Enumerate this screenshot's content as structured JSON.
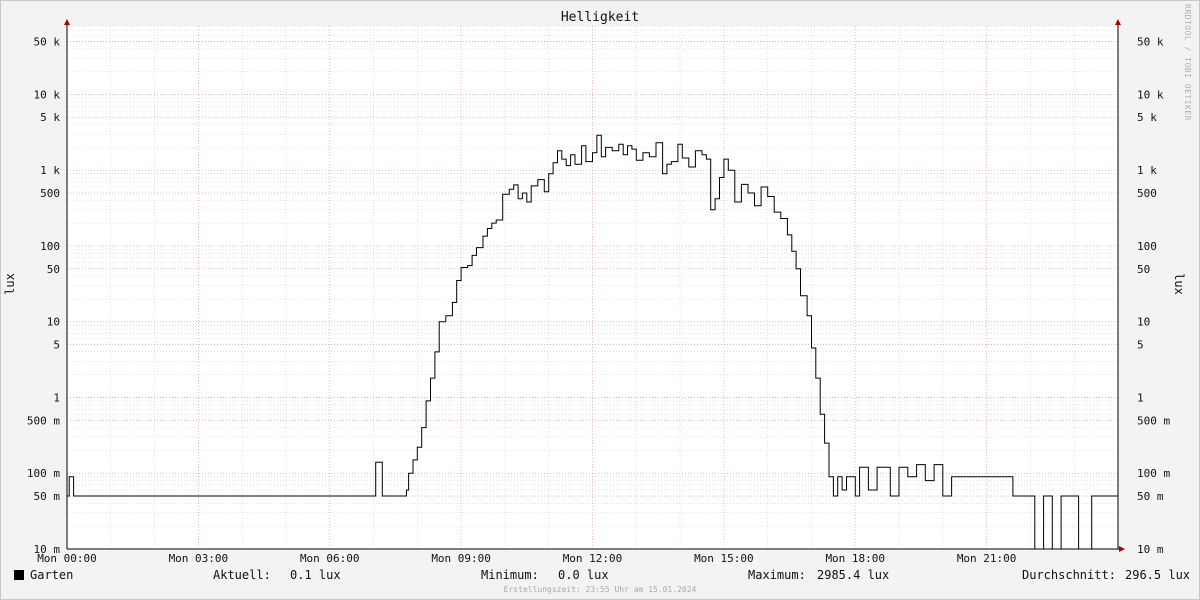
{
  "chart_data": {
    "type": "line",
    "title": "Helligkeit",
    "ylabel": "lux",
    "y_scale": "log",
    "ylim": [
      10,
      80000
    ],
    "y_ticks": [
      {
        "value": 50000,
        "label": "50 k"
      },
      {
        "value": 10000,
        "label": "10 k"
      },
      {
        "value": 5000,
        "label": "5 k"
      },
      {
        "value": 1000,
        "label": "1 k"
      },
      {
        "value": 500,
        "label": "500"
      },
      {
        "value": 100,
        "label": "100"
      },
      {
        "value": 50,
        "label": "50"
      },
      {
        "value": 10,
        "label": "10"
      },
      {
        "value": 5,
        "label": "5"
      },
      {
        "value": 1,
        "label": "1"
      },
      {
        "value": 0.5,
        "label": "500 m"
      },
      {
        "value": 0.1,
        "label": "100 m"
      },
      {
        "value": 0.05,
        "label": "50 m"
      },
      {
        "value": 0.01,
        "label": "10 m"
      }
    ],
    "x_ticks": [
      "Mon 00:00",
      "Mon 03:00",
      "Mon 06:00",
      "Mon 09:00",
      "Mon 12:00",
      "Mon 15:00",
      "Mon 18:00",
      "Mon 21:00"
    ],
    "x_unit": "hours",
    "xlim": [
      0,
      24
    ],
    "grid": true,
    "series": [
      {
        "name": "Garten",
        "color": "#000000",
        "x": [
          0,
          0.05,
          0.15,
          0.2,
          7.0,
          7.05,
          7.2,
          7.3,
          7.75,
          7.8,
          7.9,
          8.0,
          8.1,
          8.2,
          8.3,
          8.4,
          8.5,
          8.65,
          8.8,
          8.9,
          9.0,
          9.15,
          9.25,
          9.35,
          9.5,
          9.6,
          9.7,
          9.8,
          9.95,
          10.1,
          10.2,
          10.3,
          10.4,
          10.5,
          10.6,
          10.75,
          10.9,
          11.0,
          11.1,
          11.2,
          11.3,
          11.4,
          11.5,
          11.6,
          11.75,
          11.85,
          12.0,
          12.1,
          12.2,
          12.3,
          12.45,
          12.6,
          12.7,
          12.8,
          12.9,
          13.0,
          13.15,
          13.3,
          13.45,
          13.6,
          13.7,
          13.8,
          13.95,
          14.05,
          14.2,
          14.35,
          14.5,
          14.6,
          14.7,
          14.8,
          14.9,
          15.0,
          15.1,
          15.25,
          15.4,
          15.55,
          15.7,
          15.85,
          16.0,
          16.15,
          16.3,
          16.45,
          16.55,
          16.65,
          16.75,
          16.9,
          17.0,
          17.1,
          17.2,
          17.3,
          17.4,
          17.5,
          17.6,
          17.7,
          17.8,
          18.0,
          18.1,
          18.3,
          18.5,
          18.8,
          19.0,
          19.2,
          19.4,
          19.6,
          19.8,
          20.0,
          20.2,
          20.4,
          20.7,
          21.0,
          21.3,
          21.6,
          21.9,
          22.1,
          22.3,
          22.5,
          22.7,
          22.9,
          23.1,
          23.4,
          24.0
        ],
        "y": [
          0.05,
          0.09,
          0.05,
          0.05,
          0.05,
          0.14,
          0.05,
          0.05,
          0.06,
          0.1,
          0.15,
          0.22,
          0.4,
          0.9,
          1.8,
          4.0,
          10.0,
          12.0,
          18.0,
          35.0,
          52.0,
          55.0,
          75.0,
          95.0,
          135.0,
          170.0,
          200.0,
          220.0,
          480.0,
          560.0,
          640.0,
          420.0,
          500.0,
          380.0,
          620.0,
          750.0,
          520.0,
          900.0,
          1250.0,
          1800.0,
          1400.0,
          1150.0,
          1600.0,
          1200.0,
          2100.0,
          1300.0,
          1700.0,
          2900.0,
          1500.0,
          2000.0,
          1800.0,
          2200.0,
          1600.0,
          2100.0,
          1900.0,
          1350.0,
          1700.0,
          1500.0,
          2300.0,
          900.0,
          1200.0,
          1300.0,
          2200.0,
          1450.0,
          1100.0,
          1800.0,
          1600.0,
          1400.0,
          300.0,
          420.0,
          800.0,
          1400.0,
          1000.0,
          380.0,
          650.0,
          500.0,
          340.0,
          600.0,
          450.0,
          280.0,
          230.0,
          140.0,
          85.0,
          50.0,
          22.0,
          12.0,
          4.5,
          1.8,
          0.6,
          0.25,
          0.09,
          0.05,
          0.09,
          0.06,
          0.09,
          0.05,
          0.12,
          0.06,
          0.12,
          0.05,
          0.12,
          0.09,
          0.13,
          0.08,
          0.13,
          0.05,
          0.09,
          0.09,
          0.09,
          0.09,
          0.09,
          0.05,
          0.05,
          0.005,
          0.05,
          0.005,
          0.05,
          0.05,
          0.005,
          0.05,
          0.05
        ]
      }
    ]
  },
  "watermark": "RRDTOOL / TOBI OETIKER",
  "legend": {
    "series_name": "Garten",
    "current_label": "Aktuell:",
    "current_value": "0.1 lux",
    "min_label": "Minimum:",
    "min_value": "0.0 lux",
    "max_label": "Maximum:",
    "max_value": "2985.4 lux",
    "avg_label": "Durchschnitt:",
    "avg_value": "296.5 lux"
  },
  "footer": "Erstellungszeit: 23:55 Uhr am 15.01.2024",
  "colors": {
    "background": "#f3f3f3",
    "canvas": "#ffffff",
    "major_grid": "#e3a0a0",
    "minor_grid": "#cfcfcf",
    "axis": "#000000",
    "arrow": "#b00000",
    "line": "#000000"
  }
}
